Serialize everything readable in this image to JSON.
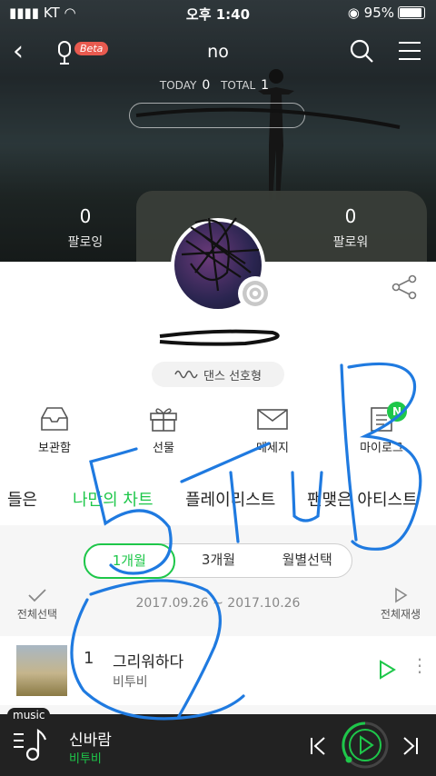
{
  "status": {
    "carrier": "KT",
    "time": "오후 1:40",
    "battery": "95%"
  },
  "nav": {
    "title": "no",
    "beta": "Beta"
  },
  "counts": {
    "today_label": "TODAY",
    "today": "0",
    "total_label": "TOTAL",
    "total": "1"
  },
  "follow": {
    "following_count": "0",
    "following_label": "팔로잉",
    "follower_count": "0",
    "follower_label": "팔로워"
  },
  "profile": {
    "genre": "댄스 선호형"
  },
  "actions": [
    {
      "label": "보관함"
    },
    {
      "label": "선물"
    },
    {
      "label": "메세지"
    },
    {
      "label": "마이로그",
      "badge": "N"
    }
  ],
  "tabs": [
    "들은",
    "나만의 차트",
    "플레이리스트",
    "팬맺은 아티스트"
  ],
  "period": {
    "options": [
      "1개월",
      "3개월",
      "월별선택"
    ],
    "selected": "1개월"
  },
  "list_controls": {
    "select_all": "전체선택",
    "range": "2017.09.26 ~ 2017.10.26",
    "play_all": "전체재생"
  },
  "songs": [
    {
      "rank": "1",
      "title": "그리워하다",
      "artist": "비투비"
    }
  ],
  "player": {
    "tag": "music",
    "title": "신바람",
    "artist": "비투비"
  },
  "colors": {
    "accent": "#1ec74a",
    "scribble": "#1f7ae0"
  }
}
